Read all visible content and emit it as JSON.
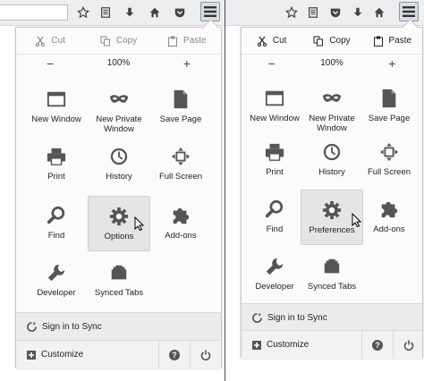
{
  "colors": {
    "icon": "#555555",
    "icon_light": "#9a9a9a",
    "toolbar": "#eceef0",
    "panel": "#fbfbfb",
    "highlight": "#e5e5e5"
  },
  "left": {
    "edit": {
      "cut": "Cut",
      "copy": "Copy",
      "paste": "Paste"
    },
    "zoom": {
      "minus": "−",
      "level": "100%",
      "plus": "+"
    },
    "items": [
      {
        "label": "New Window",
        "icon": "window-icon"
      },
      {
        "label": "New Private\nWindow",
        "icon": "mask-icon"
      },
      {
        "label": "Save Page",
        "icon": "page-icon"
      },
      {
        "label": "Print",
        "icon": "printer-icon"
      },
      {
        "label": "History",
        "icon": "clock-icon"
      },
      {
        "label": "Full Screen",
        "icon": "fullscreen-icon"
      },
      {
        "label": "Find",
        "icon": "magnifier-icon"
      },
      {
        "label": "Options",
        "icon": "gear-icon"
      },
      {
        "label": "Add-ons",
        "icon": "puzzle-icon"
      },
      {
        "label": "Developer",
        "icon": "wrench-icon"
      },
      {
        "label": "Synced Tabs",
        "icon": "synced-tabs-icon"
      }
    ],
    "sync": "Sign in to Sync",
    "customize": "Customize"
  },
  "right": {
    "edit": {
      "cut": "Cut",
      "copy": "Copy",
      "paste": "Paste"
    },
    "zoom": {
      "minus": "−",
      "level": "100%",
      "plus": "+"
    },
    "items": [
      {
        "label": "New Window",
        "icon": "window-icon"
      },
      {
        "label": "New Private\nWindow",
        "icon": "mask-icon"
      },
      {
        "label": "Save Page",
        "icon": "page-icon"
      },
      {
        "label": "Print",
        "icon": "printer-icon"
      },
      {
        "label": "History",
        "icon": "clock-icon"
      },
      {
        "label": "Full Screen",
        "icon": "fullscreen-icon"
      },
      {
        "label": "Find",
        "icon": "magnifier-icon"
      },
      {
        "label": "Preferences",
        "icon": "gear-icon"
      },
      {
        "label": "Add-ons",
        "icon": "puzzle-icon"
      },
      {
        "label": "Developer",
        "icon": "wrench-icon"
      },
      {
        "label": "Synced Tabs",
        "icon": "synced-tabs-icon"
      }
    ],
    "sync": "Sign in to Sync",
    "customize": "Customize"
  }
}
